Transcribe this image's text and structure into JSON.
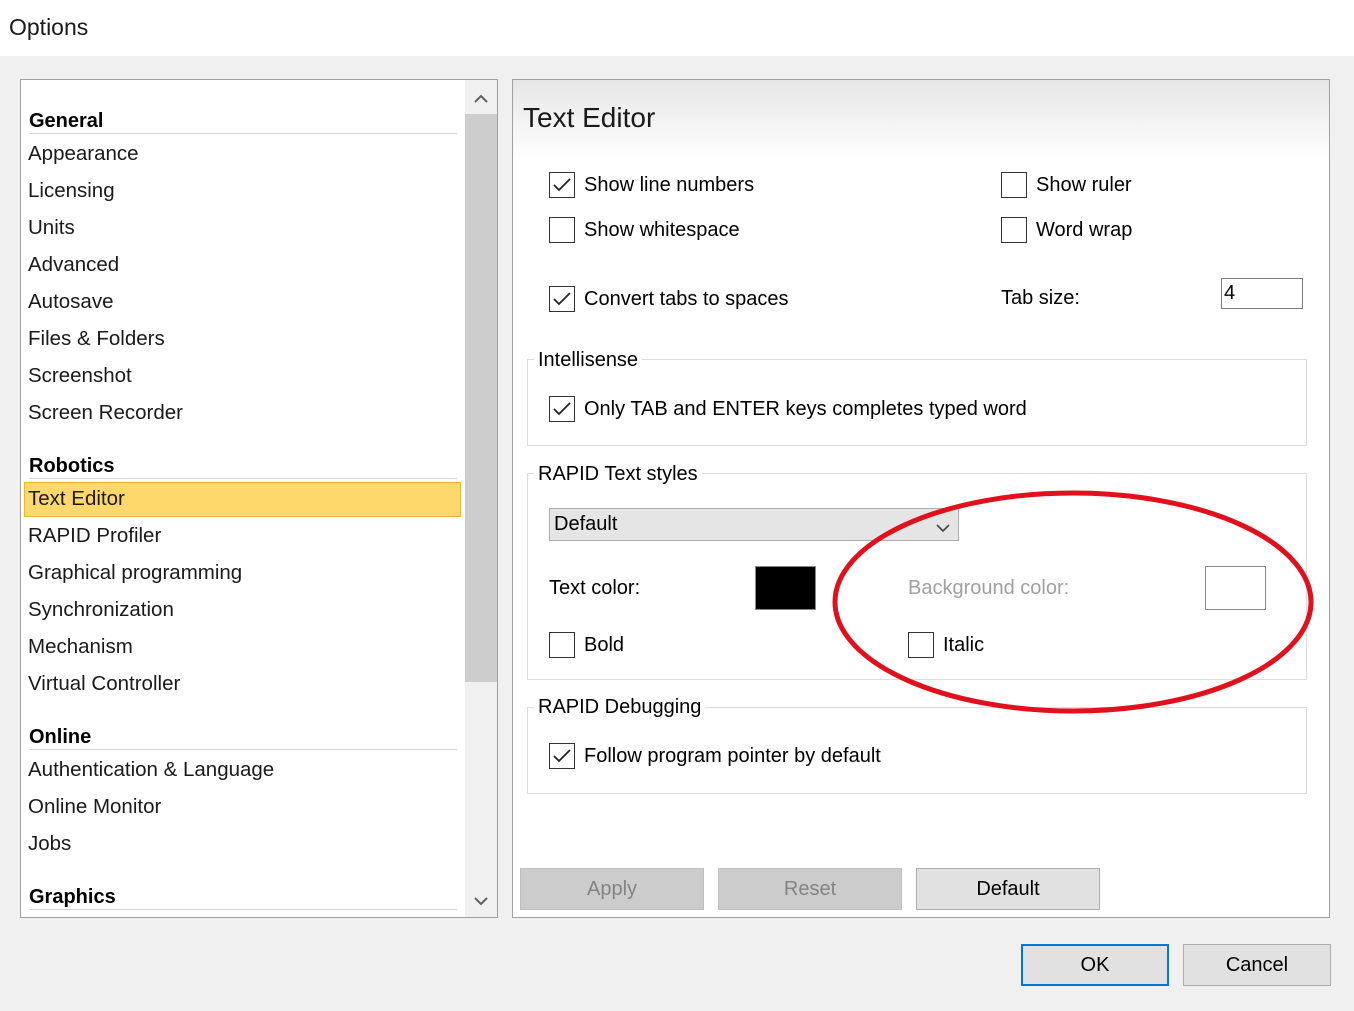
{
  "window": {
    "title": "Options"
  },
  "nav": {
    "items": [
      {
        "kind": "header",
        "label": "General"
      },
      {
        "kind": "item",
        "label": "Appearance"
      },
      {
        "kind": "item",
        "label": "Licensing"
      },
      {
        "kind": "item",
        "label": "Units"
      },
      {
        "kind": "item",
        "label": "Advanced"
      },
      {
        "kind": "item",
        "label": "Autosave"
      },
      {
        "kind": "item",
        "label": "Files & Folders"
      },
      {
        "kind": "item",
        "label": "Screenshot"
      },
      {
        "kind": "item",
        "label": "Screen Recorder"
      },
      {
        "kind": "header",
        "label": "Robotics"
      },
      {
        "kind": "item",
        "label": "Text Editor",
        "selected": true
      },
      {
        "kind": "item",
        "label": "RAPID Profiler"
      },
      {
        "kind": "item",
        "label": "Graphical programming"
      },
      {
        "kind": "item",
        "label": "Synchronization"
      },
      {
        "kind": "item",
        "label": "Mechanism"
      },
      {
        "kind": "item",
        "label": "Virtual Controller"
      },
      {
        "kind": "header",
        "label": "Online"
      },
      {
        "kind": "item",
        "label": "Authentication & Language"
      },
      {
        "kind": "item",
        "label": "Online Monitor"
      },
      {
        "kind": "item",
        "label": "Jobs"
      },
      {
        "kind": "header",
        "label": "Graphics"
      }
    ]
  },
  "panel": {
    "title": "Text Editor",
    "options": {
      "show_line_numbers": {
        "label": "Show line numbers",
        "checked": true
      },
      "show_ruler": {
        "label": "Show ruler",
        "checked": false
      },
      "show_whitespace": {
        "label": "Show whitespace",
        "checked": false
      },
      "word_wrap": {
        "label": "Word wrap",
        "checked": false
      },
      "convert_tabs": {
        "label": "Convert tabs to spaces",
        "checked": true
      },
      "tab_size_label": "Tab size:",
      "tab_size_value": "4"
    },
    "intellisense": {
      "title": "Intellisense",
      "tab_enter": {
        "label": "Only TAB and ENTER keys completes typed word",
        "checked": true
      }
    },
    "text_styles": {
      "title": "RAPID Text styles",
      "style_selected": "Default",
      "text_color_label": "Text color:",
      "text_color": "#000000",
      "background_color_label": "Background color:",
      "background_color": "#ffffff",
      "bold": {
        "label": "Bold",
        "checked": false
      },
      "italic": {
        "label": "Italic",
        "checked": false
      }
    },
    "debugging": {
      "title": "RAPID Debugging",
      "follow_pointer": {
        "label": "Follow program pointer by default",
        "checked": true
      }
    },
    "buttons": {
      "apply": "Apply",
      "reset": "Reset",
      "default": "Default"
    }
  },
  "footer": {
    "ok": "OK",
    "cancel": "Cancel"
  },
  "colors": {
    "selection": "#ffd86b",
    "annotation": "#e0101c",
    "focus": "#0078d7"
  }
}
